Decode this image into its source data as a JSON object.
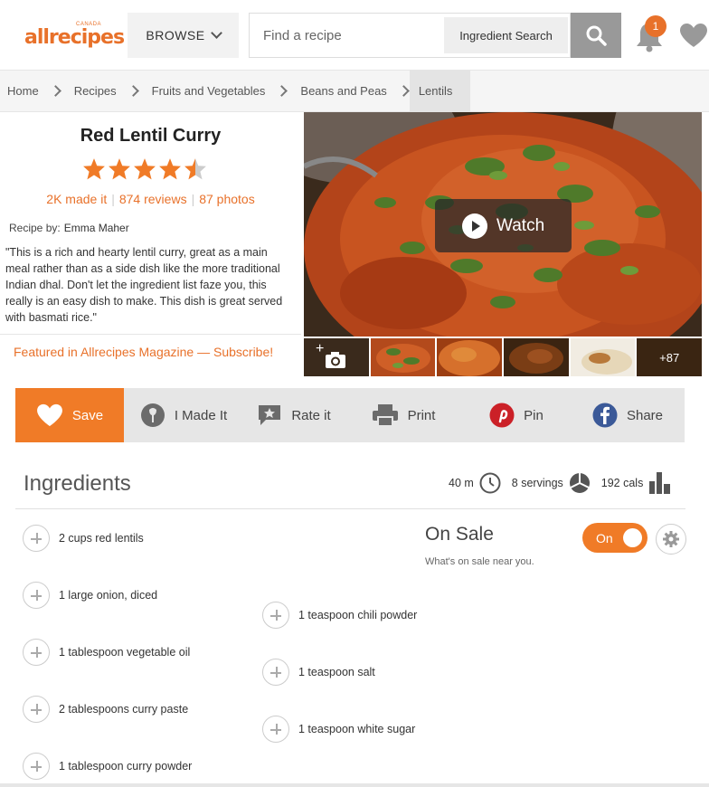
{
  "header": {
    "logo_text": "allrecipes",
    "logo_region": "CANADA",
    "browse_label": "BROWSE",
    "search_placeholder": "Find a recipe",
    "ingredient_search_label": "Ingredient Search",
    "notification_count": "1",
    "brand_color": "#e8712a"
  },
  "breadcrumb": [
    "Home",
    "Recipes",
    "Fruits and Vegetables",
    "Beans and Peas",
    "Lentils"
  ],
  "recipe": {
    "title": "Red Lentil Curry",
    "rating": 4.5,
    "made_it": "2K made it",
    "reviews": "874 reviews",
    "photos": "87 photos",
    "recipe_by_label": "Recipe by:",
    "author": "Emma Maher",
    "description": "\"This is a rich and hearty lentil curry, great as a main meal rather than as a side dish like the more traditional Indian dhal. Don't let the ingredient list faze you, this really is an easy dish to make. This dish is great served with basmati rice.\"",
    "featured": "Featured in Allrecipes Magazine — Subscribe!"
  },
  "media": {
    "watch_label": "Watch",
    "more_photos": "+87"
  },
  "actions": {
    "save": "Save",
    "made_it": "I Made It",
    "rate": "Rate it",
    "print": "Print",
    "pin": "Pin",
    "share": "Share"
  },
  "ingredients": {
    "title": "Ingredients",
    "time": "40 m",
    "servings": "8 servings",
    "cals": "192 cals",
    "left": [
      "2 cups red lentils",
      "1 large onion, diced",
      "1 tablespoon vegetable oil",
      "2 tablespoons curry paste",
      "1 tablespoon curry powder"
    ],
    "right": [
      "1 teaspoon chili powder",
      "1 teaspoon salt",
      "1 teaspoon white sugar"
    ]
  },
  "on_sale": {
    "title": "On Sale",
    "subtitle": "What's on sale near you.",
    "toggle_label": "On"
  }
}
